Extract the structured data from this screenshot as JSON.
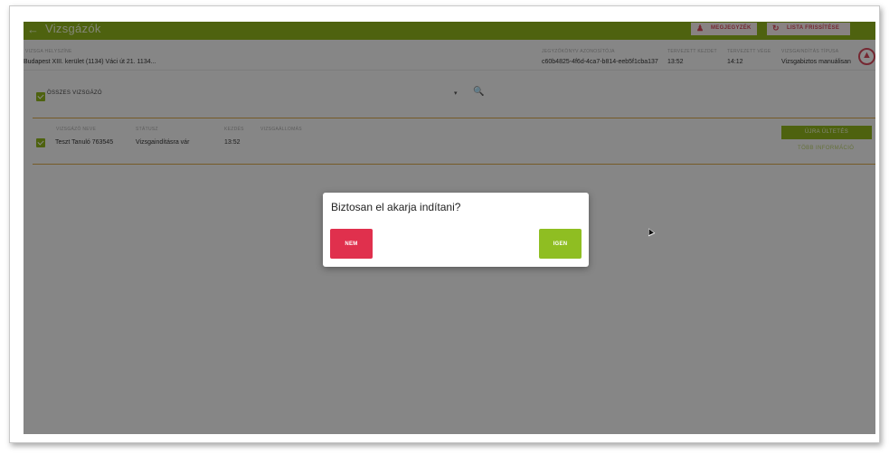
{
  "header": {
    "title": "Vizsgázók",
    "back_icon": "arrow-left-icon",
    "btn_notes": "MEGJEGYZÉK",
    "btn_refresh": "LISTA FRISSÍTÉSE"
  },
  "info": {
    "location_label": "Vizsga helyszíne",
    "location_value": "Budapest XIII. kerület (1134) Váci út 21. 1134...",
    "id_label": "Jegyzőkönyv azonosítója",
    "id_value": "c60b4825-4f6d-4ca7-b814-eeb5f1cba137",
    "start_label": "Tervezett kezdet",
    "start_value": "13:52",
    "end_label": "Tervezett vége",
    "end_value": "14:12",
    "type_label": "Vizsgaindítás típusa",
    "type_value": "Vizsgabiztos manuálisan"
  },
  "filter": {
    "label": "ÖSSZES VIZSGÁZÓ"
  },
  "table": {
    "col_name": "Vizsgázó neve",
    "col_status": "Státusz",
    "col_start": "Kezdés",
    "col_seat": "Vizsgaállomás",
    "rows": [
      {
        "name": "Teszt Tanuló 763545",
        "status": "Vizsgaindításra vár",
        "start": "13:52"
      }
    ],
    "reseat_button": "ÚJRA ÜLTETÉS",
    "more_info_link": "TÖBB INFORMÁCIÓ"
  },
  "dialog": {
    "question": "Biztosan el akarja indítani?",
    "no_label": "NEM",
    "yes_label": "IGEN"
  },
  "colors": {
    "brand_green": "#8fb31c",
    "danger_red": "#e0304d",
    "confirm_green": "#8fbe22"
  }
}
